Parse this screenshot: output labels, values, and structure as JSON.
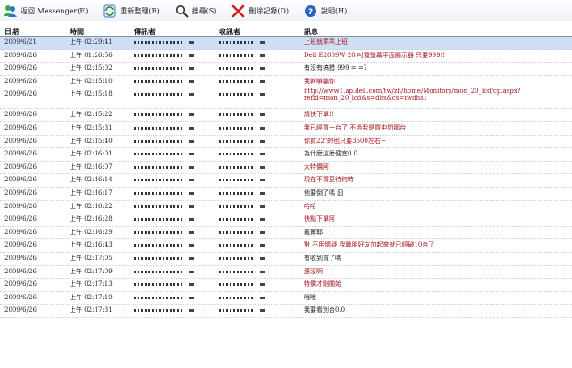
{
  "toolbar": {
    "back_label": "返回 Messenger(E)",
    "refresh_label": "重新整理(R)",
    "search_label": "搜尋(S)",
    "delete_label": "刪除記錄(D)",
    "help_label": "說明(H)"
  },
  "columns": {
    "date": "日期",
    "time": "時間",
    "from": "傳訊者",
    "to": "收訊者",
    "message": "訊息"
  },
  "rows": [
    {
      "date": "2009/6/21",
      "time": "上午 02:29:41",
      "message": "上班就乖乖上班",
      "color": "red"
    },
    {
      "date": "2009/6/26",
      "time": "上午 01:26:56",
      "message": "Dell E2009W 20 吋寬螢幕平面顯示器 只要999!!",
      "color": "red"
    },
    {
      "date": "2009/6/26",
      "time": "上午 02:15:02",
      "message": "有沒有搞錯 999 = =?",
      "color": "black"
    },
    {
      "date": "2009/6/26",
      "time": "上午 02:15:10",
      "message": "我幹嘛騙你",
      "color": "red"
    },
    {
      "date": "2009/6/26",
      "time": "上午 02:15:18",
      "message": "http://www1.ap.dell.com/tw/zh/home/Monitors/mon_20_lcd/cp.aspx?refid=mon_20_lcd&s=dhs&cs=twdhs1",
      "color": "red",
      "wrap": true
    },
    {
      "date": "2009/6/26",
      "time": "上午 02:15:22",
      "message": "請快下單!!",
      "color": "red"
    },
    {
      "date": "2009/6/26",
      "time": "上午 02:15:31",
      "message": "我已經買一台了 不過我是買中間那台",
      "color": "red"
    },
    {
      "date": "2009/6/26",
      "time": "上午 02:15:40",
      "message": "你買22\"的也只要3500左右~",
      "color": "red"
    },
    {
      "date": "2009/6/26",
      "time": "上午 02:16:01",
      "message": "為什麼這麼便宜0.0",
      "color": "black"
    },
    {
      "date": "2009/6/26",
      "time": "上午 02:16:07",
      "message": "大特價阿",
      "color": "red"
    },
    {
      "date": "2009/6/26",
      "time": "上午 02:16:14",
      "message": "現在不買更待何時",
      "color": "red"
    },
    {
      "date": "2009/6/26",
      "time": "上午 02:16:17",
      "message": "他要倒了嗎 囧",
      "color": "black"
    },
    {
      "date": "2009/6/26",
      "time": "上午 02:16:22",
      "message": "哈哈",
      "color": "red"
    },
    {
      "date": "2009/6/26",
      "time": "上午 02:16:28",
      "message": "快點下單阿",
      "color": "red"
    },
    {
      "date": "2009/6/26",
      "time": "上午 02:16:29",
      "message": "戴爾耶",
      "color": "black"
    },
    {
      "date": "2009/6/26",
      "time": "上午 02:16:43",
      "message": "對 不用懷疑 我職朋好友加起來就已經破10台了",
      "color": "red"
    },
    {
      "date": "2009/6/26",
      "time": "上午 02:17:05",
      "message": "有收到貨了嗎",
      "color": "black"
    },
    {
      "date": "2009/6/26",
      "time": "上午 02:17:09",
      "message": "還沒啊",
      "color": "red"
    },
    {
      "date": "2009/6/26",
      "time": "上午 02:17:13",
      "message": "特價才剛開始",
      "color": "red"
    },
    {
      "date": "2009/6/26",
      "time": "上午 02:17:19",
      "message": "哦哦",
      "color": "black"
    },
    {
      "date": "2009/6/26",
      "time": "上午 02:17:31",
      "message": "我要看別台0.0",
      "color": "black"
    }
  ]
}
